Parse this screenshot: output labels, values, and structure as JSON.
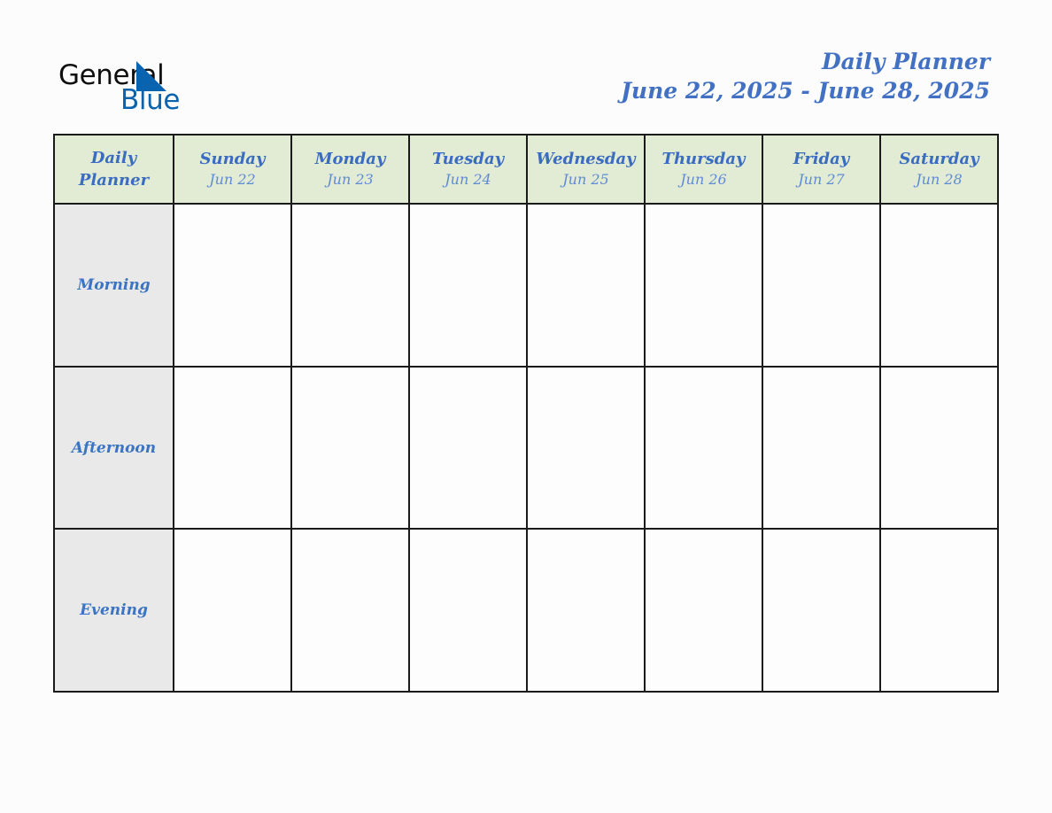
{
  "page": {
    "background_color": "#FCFCFC"
  },
  "logo": {
    "name": "general-blue-logo",
    "word_one": "General",
    "word_two": "Blue",
    "word_one_color": "#0F0F0F",
    "word_two_color": "#0A63AE",
    "sail_icon": "blue-sail-triangle-icon",
    "sail_color": "#0A63AE"
  },
  "header": {
    "title": "Daily Planner",
    "date_range": "June 22, 2025 - June 28, 2025",
    "title_color": "#4271C4"
  },
  "table": {
    "corner_label_line1": "Daily",
    "corner_label_line2": "Planner",
    "header_bg": "#E2EBD4",
    "label_bg": "#E9E9E9",
    "cell_bg": "#FDFDFD",
    "border_color": "#1A1A1A",
    "day_name_color": "#3A6CC0",
    "day_date_color": "#5E8BD4",
    "row_label_color": "#3A74C2",
    "columns": [
      {
        "day": "Sunday",
        "date": "Jun 22"
      },
      {
        "day": "Monday",
        "date": "Jun 23"
      },
      {
        "day": "Tuesday",
        "date": "Jun 24"
      },
      {
        "day": "Wednesday",
        "date": "Jun 25"
      },
      {
        "day": "Thursday",
        "date": "Jun 26"
      },
      {
        "day": "Friday",
        "date": "Jun 27"
      },
      {
        "day": "Saturday",
        "date": "Jun 28"
      }
    ],
    "rows": [
      {
        "label": "Morning"
      },
      {
        "label": "Afternoon"
      },
      {
        "label": "Evening"
      }
    ]
  }
}
